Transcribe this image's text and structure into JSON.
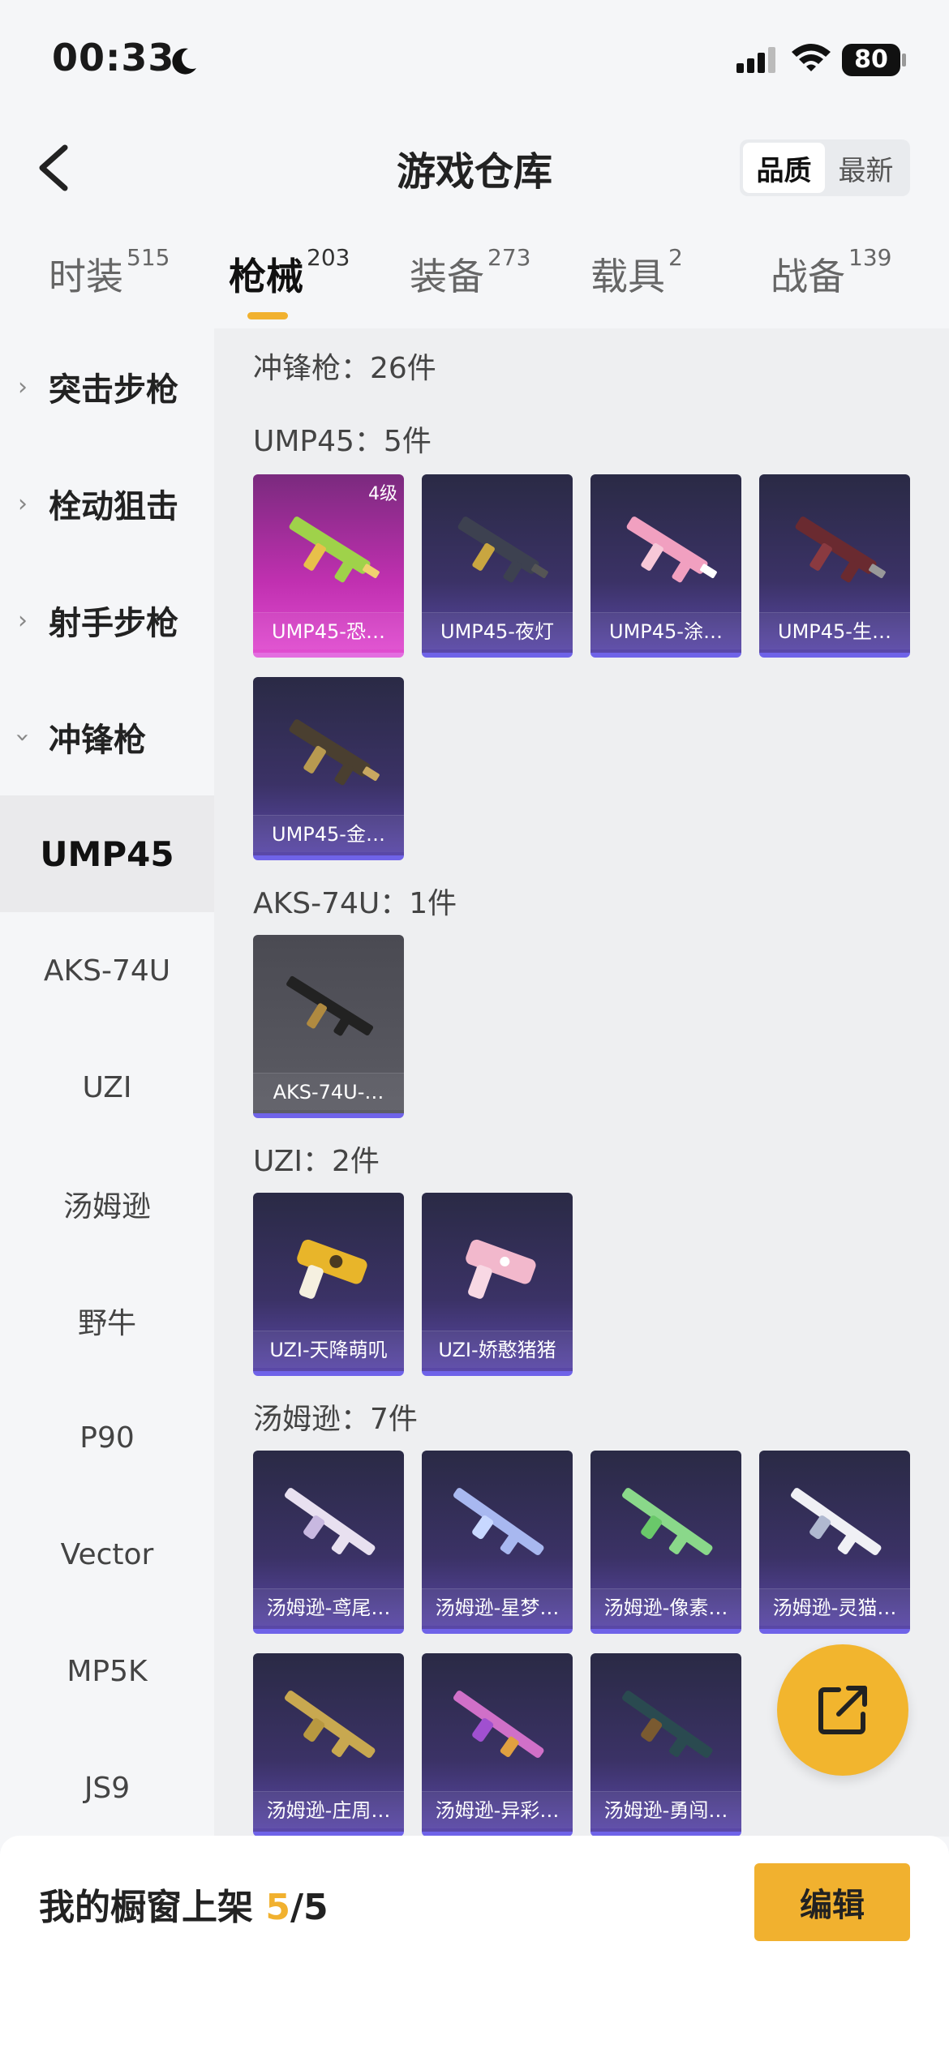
{
  "status_bar": {
    "time": "00:33",
    "battery": "80"
  },
  "header": {
    "title": "游戏仓库",
    "sort_quality": "品质",
    "sort_newest": "最新"
  },
  "tabs": [
    {
      "label": "时装",
      "count": "515"
    },
    {
      "label": "枪械",
      "count": "203"
    },
    {
      "label": "装备",
      "count": "273"
    },
    {
      "label": "载具",
      "count": "2"
    },
    {
      "label": "战备",
      "count": "139"
    }
  ],
  "sidebar": {
    "groups": [
      "突击步枪",
      "栓动狙击",
      "射手步枪",
      "冲锋枪"
    ],
    "items": [
      "UMP45",
      "AKS-74U",
      "UZI",
      "汤姆逊",
      "野牛",
      "P90",
      "Vector",
      "MP5K",
      "JS9"
    ]
  },
  "content": {
    "category_total": "冲锋枪：26件",
    "sections": [
      {
        "label": "UMP45：5件",
        "cards": [
          {
            "name": "UMP45-恐…",
            "level": "4级"
          },
          {
            "name": "UMP45-夜灯"
          },
          {
            "name": "UMP45-涂…"
          },
          {
            "name": "UMP45-生…"
          },
          {
            "name": "UMP45-金…"
          }
        ]
      },
      {
        "label": "AKS-74U：1件",
        "cards": [
          {
            "name": "AKS-74U-…"
          }
        ]
      },
      {
        "label": "UZI：2件",
        "cards": [
          {
            "name": "UZI-天降萌叽"
          },
          {
            "name": "UZI-娇憨猪猪"
          }
        ]
      },
      {
        "label": "汤姆逊：7件",
        "cards": [
          {
            "name": "汤姆逊-鸢尾…"
          },
          {
            "name": "汤姆逊-星梦…"
          },
          {
            "name": "汤姆逊-像素…"
          },
          {
            "name": "汤姆逊-灵猫…"
          },
          {
            "name": "汤姆逊-庄周…"
          },
          {
            "name": "汤姆逊-异彩…"
          },
          {
            "name": "汤姆逊-勇闯…"
          }
        ]
      }
    ]
  },
  "bottom_bar": {
    "label": "我的橱窗上架",
    "current": "5",
    "total": "/5",
    "edit_label": "编辑"
  },
  "colors": {
    "accent": "#f1b12f",
    "card_purple": "#3b3266",
    "card_pink": "#c030b0"
  }
}
